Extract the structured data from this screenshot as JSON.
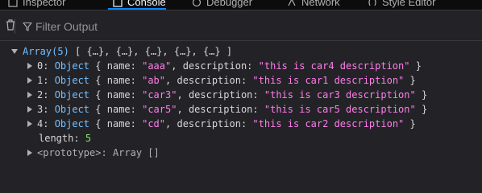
{
  "tabs": [
    {
      "label": "Inspector",
      "icon": "inspector-icon"
    },
    {
      "label": "Console",
      "icon": "console-icon",
      "active": true
    },
    {
      "label": "Debugger",
      "icon": "debugger-icon"
    },
    {
      "label": "Network",
      "icon": "network-icon"
    },
    {
      "label": "Style Editor",
      "icon": "style-editor-icon"
    }
  ],
  "toolbar": {
    "filter_placeholder": "Filter Output"
  },
  "console": {
    "array_head": {
      "label": "Array(5)",
      "preview": "[ {…}, {…}, {…}, {…}, {…} ]"
    },
    "items": [
      {
        "index": "0:",
        "type": "Object",
        "open": "{",
        "name_key": "name:",
        "name_val": "\"aaa\"",
        "desc_key": "description:",
        "desc_val": "\"this is car4 description\"",
        "close": "}"
      },
      {
        "index": "1:",
        "type": "Object",
        "open": "{",
        "name_key": "name:",
        "name_val": "\"ab\"",
        "desc_key": "description:",
        "desc_val": "\"this is car1 description\"",
        "close": "}"
      },
      {
        "index": "2:",
        "type": "Object",
        "open": "{",
        "name_key": "name:",
        "name_val": "\"car3\"",
        "desc_key": "description:",
        "desc_val": "\"this is car3 description\"",
        "close": "}"
      },
      {
        "index": "3:",
        "type": "Object",
        "open": "{",
        "name_key": "name:",
        "name_val": "\"car5\"",
        "desc_key": "description:",
        "desc_val": "\"this is car5 description\"",
        "close": "}"
      },
      {
        "index": "4:",
        "type": "Object",
        "open": "{",
        "name_key": "name:",
        "name_val": "\"cd\"",
        "desc_key": "description:",
        "desc_val": "\"this is car2 description\"",
        "close": "}"
      }
    ],
    "length_key": "length:",
    "length_val": "5",
    "prototype_key": "<prototype>:",
    "prototype_val": "Array []"
  },
  "colors": {
    "background": "#232327",
    "label": "#75bfff",
    "string": "#ff7de9",
    "number": "#86de74",
    "text": "#d7d7db"
  }
}
